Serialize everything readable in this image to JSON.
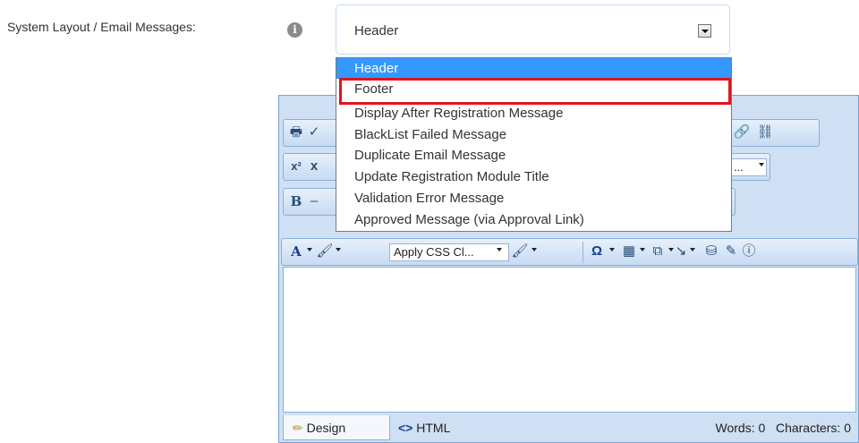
{
  "field": {
    "label": "System Layout / Email Messages:",
    "info_icon": "info-icon"
  },
  "select": {
    "value": "Header",
    "options": [
      "Header",
      "Footer",
      "Display After Registration Message",
      "BlackList Failed Message",
      "Duplicate Email Message",
      "Update Registration Module Title",
      "Validation Error Message",
      "Approved Message (via Approval Link)"
    ],
    "highlighted_option": "Footer"
  },
  "editor": {
    "toolbar": {
      "font_color_glyph": "A",
      "superscript_glyph": "x²",
      "bold_glyph": "B",
      "css_class_placeholder": "Apply CSS Cl...",
      "omega_glyph": "Ω",
      "truncated_dropdown": "..."
    },
    "modes": {
      "design": "Design",
      "html": "HTML"
    },
    "stats": {
      "words_label": "Words: 0",
      "chars_label": "Characters: 0"
    }
  },
  "colors": {
    "selected_option": "#3399ff",
    "highlight_border": "#e0141e",
    "editor_bg": "#cfe0f4"
  }
}
